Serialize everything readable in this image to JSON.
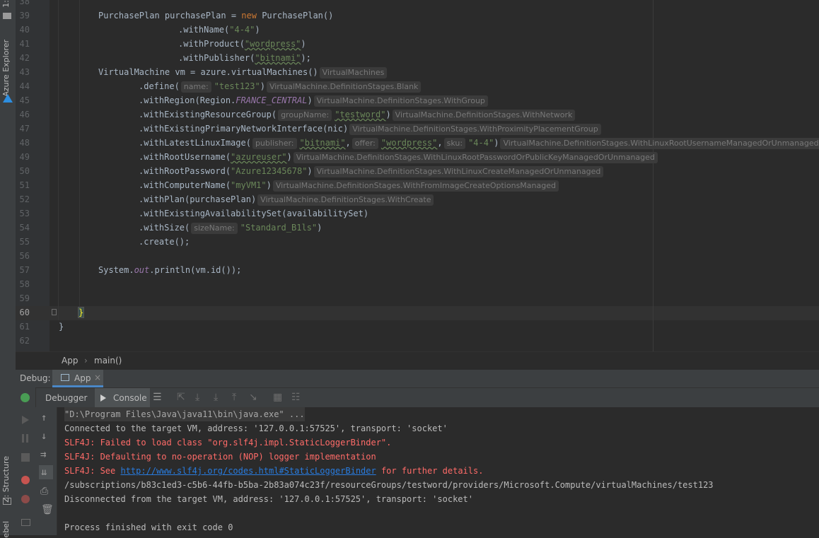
{
  "left_strip": {
    "tabs": [
      "1:",
      "Azure Explorer",
      "Z: Structure",
      "ebel"
    ]
  },
  "editor": {
    "lines": [
      {
        "n": "38"
      },
      {
        "n": "39"
      },
      {
        "n": "40"
      },
      {
        "n": "41"
      },
      {
        "n": "42"
      },
      {
        "n": "43"
      },
      {
        "n": "44"
      },
      {
        "n": "45"
      },
      {
        "n": "46"
      },
      {
        "n": "47"
      },
      {
        "n": "48"
      },
      {
        "n": "49"
      },
      {
        "n": "50"
      },
      {
        "n": "51"
      },
      {
        "n": "52"
      },
      {
        "n": "53"
      },
      {
        "n": "54"
      },
      {
        "n": "55"
      },
      {
        "n": "56"
      },
      {
        "n": "57"
      },
      {
        "n": "58"
      },
      {
        "n": "59"
      },
      {
        "n": "60"
      },
      {
        "n": "61"
      },
      {
        "n": "62"
      }
    ],
    "code": {
      "l39": "PurchasePlan purchasePlan = ",
      "l39_kw": "new",
      "l39_end": " PurchasePlan()",
      "l40_a": ".withName(",
      "l40_s": "\"4-4\"",
      "l40_e": ")",
      "l41_a": ".withProduct(",
      "l41_s": "\"wordpress\"",
      "l41_e": ")",
      "l42_a": ".withPublisher(",
      "l42_s": "\"bitnami\"",
      "l42_e": ");",
      "l43_a": "VirtualMachine vm = azure.virtualMachines()",
      "l43_h": "VirtualMachines",
      "l44_a": ".define(",
      "l44_p": "name:",
      "l44_s": "\"test123\"",
      "l44_e": ")",
      "l44_h": "VirtualMachine.DefinitionStages.Blank",
      "l45_a": ".withRegion(Region.",
      "l45_c": "FRANCE_CENTRAL",
      "l45_e": ")",
      "l45_h": "VirtualMachine.DefinitionStages.WithGroup",
      "l46_a": ".withExistingResourceGroup(",
      "l46_p": "groupName:",
      "l46_s": "\"testword\"",
      "l46_e": ")",
      "l46_h": "VirtualMachine.DefinitionStages.WithNetwork",
      "l47_a": ".withExistingPrimaryNetworkInterface(nic)",
      "l47_h": "VirtualMachine.DefinitionStages.WithProximityPlacementGroup",
      "l48_a": ".withLatestLinuxImage(",
      "l48_p1": "publisher:",
      "l48_s1": "\"bitnami\"",
      "l48_c1": ",",
      "l48_p2": "offer:",
      "l48_s2": "\"wordpress\"",
      "l48_c2": ",",
      "l48_p3": "sku:",
      "l48_s3": "\"4-4\"",
      "l48_e": ")",
      "l48_h": "VirtualMachine.DefinitionStages.WithLinuxRootUsernameManagedOrUnmanaged",
      "l49_a": ".withRootUsername(",
      "l49_s": "\"azureuser\"",
      "l49_e": ")",
      "l49_h": "VirtualMachine.DefinitionStages.WithLinuxRootPasswordOrPublicKeyManagedOrUnmanaged",
      "l50_a": ".withRootPassword(",
      "l50_s": "\"Azure12345678\"",
      "l50_e": ")",
      "l50_h": "VirtualMachine.DefinitionStages.WithLinuxCreateManagedOrUnmanaged",
      "l51_a": ".withComputerName(",
      "l51_s": "\"myVM1\"",
      "l51_e": ")",
      "l51_h": "VirtualMachine.DefinitionStages.WithFromImageCreateOptionsManaged",
      "l52_a": ".withPlan(purchasePlan)",
      "l52_h": "VirtualMachine.DefinitionStages.WithCreate",
      "l53_a": ".withExistingAvailabilitySet(availabilitySet)",
      "l54_a": ".withSize(",
      "l54_p": "sizeName:",
      "l54_s": "\"Standard_B1ls\"",
      "l54_e": ")",
      "l55_a": ".create();",
      "l57_a": "System.",
      "l57_o": "out",
      "l57_e": ".println(vm.id());",
      "l60_a": "}",
      "l61_a": "}"
    }
  },
  "breadcrumb": {
    "class_name": "App",
    "method": "main()",
    "sep": "›"
  },
  "debug": {
    "label": "Debug:",
    "session_tab": "App",
    "close": "×",
    "tabs": {
      "debugger": "Debugger",
      "console": "Console"
    }
  },
  "console": {
    "lines": [
      "\"D:\\Program Files\\Java\\java11\\bin\\java.exe\" ...",
      "Connected to the target VM, address: '127.0.0.1:57525', transport: 'socket'",
      "SLF4J: Failed to load class \"org.slf4j.impl.StaticLoggerBinder\".",
      "SLF4J: Defaulting to no-operation (NOP) logger implementation",
      "SLF4J: See ",
      "/subscriptions/b83c1ed3-c5b6-44fb-b5ba-2b83a074c23f/resourceGroups/testword/providers/Microsoft.Compute/virtualMachines/test123",
      "Disconnected from the target VM, address: '127.0.0.1:57525', transport: 'socket'",
      "",
      "Process finished with exit code 0"
    ],
    "link": "http://www.slf4j.org/codes.html#StaticLoggerBinder",
    "link_suffix": " for further details."
  },
  "colors": {
    "accent_blue": "#287bde",
    "error_red": "#ff6b68",
    "string_green": "#6a8759",
    "keyword_orange": "#cc7832"
  }
}
